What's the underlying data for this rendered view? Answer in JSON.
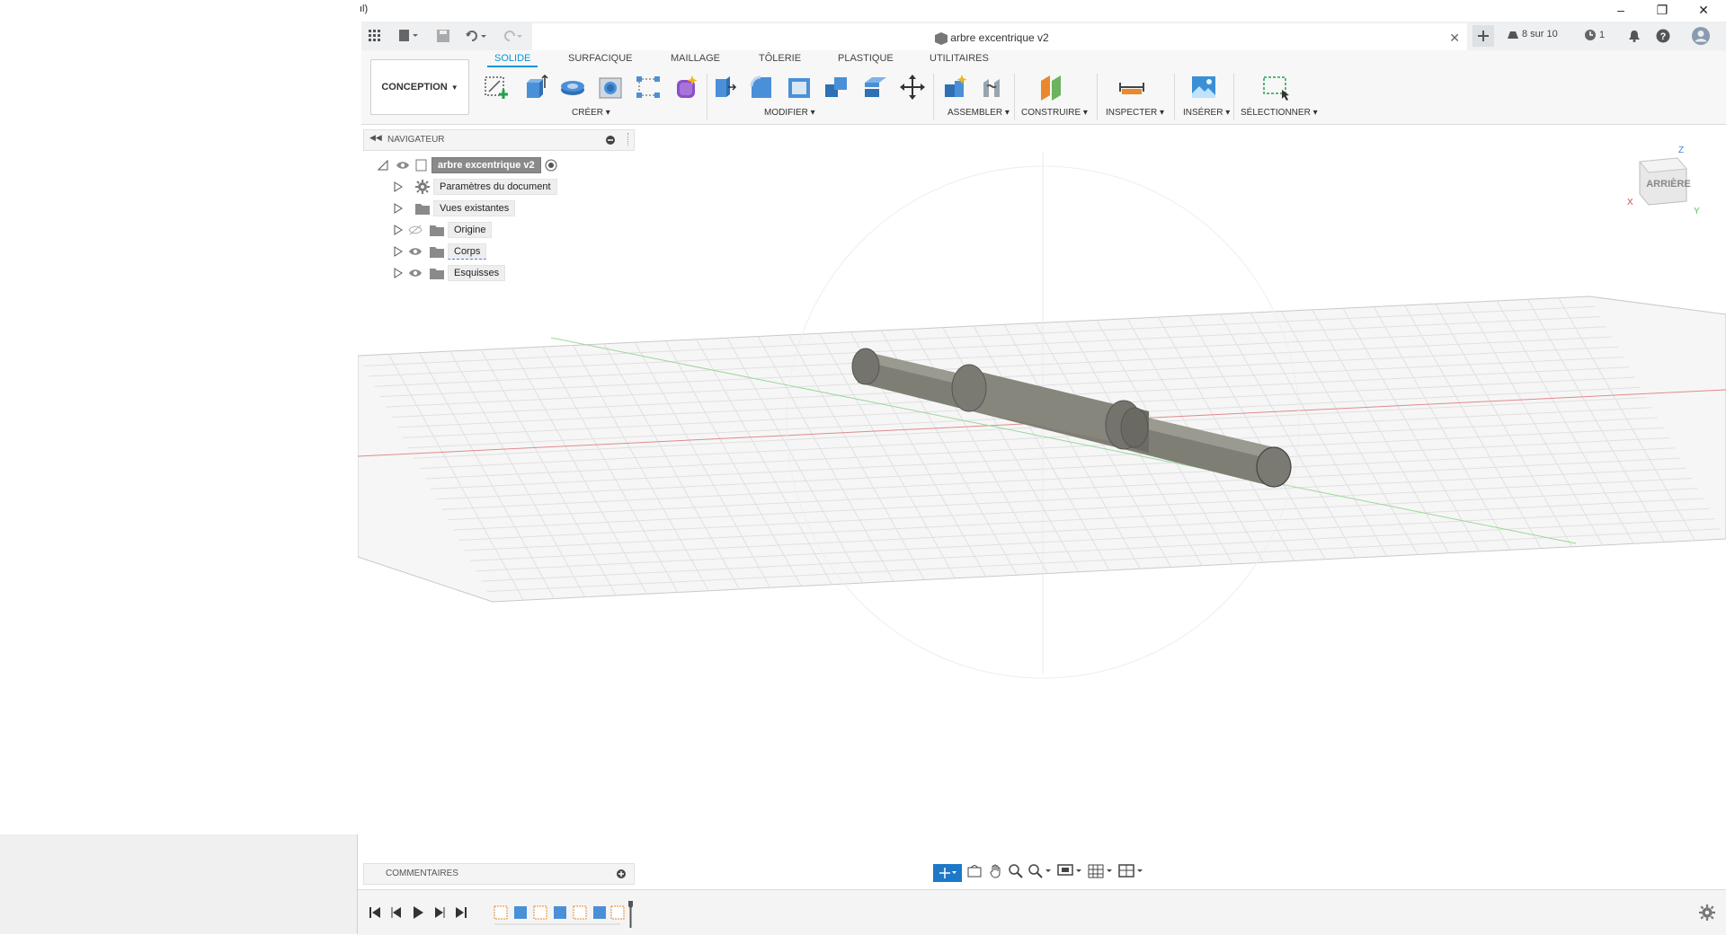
{
  "system": {
    "indicator": "ıl)"
  },
  "window": {
    "minimize_icon": "minimize-icon",
    "maximize_icon": "restore-icon",
    "close_icon": "close-icon"
  },
  "appbar": {
    "document_title": "arbre excentrique v2",
    "version_status": "8 sur 10",
    "jobs_count": "1"
  },
  "ribbon": {
    "workspace": "CONCEPTION",
    "tabs": [
      {
        "label": "SOLIDE",
        "active": true
      },
      {
        "label": "SURFACIQUE",
        "active": false
      },
      {
        "label": "MAILLAGE",
        "active": false
      },
      {
        "label": "TÔLERIE",
        "active": false
      },
      {
        "label": "PLASTIQUE",
        "active": false
      },
      {
        "label": "UTILITAIRES",
        "active": false
      }
    ],
    "groups": {
      "create": "CRÉER",
      "modify": "MODIFIER",
      "assemble": "ASSEMBLER",
      "construct": "CONSTRUIRE",
      "inspect": "INSPECTER",
      "insert": "INSÉRER",
      "select": "SÉLECTIONNER"
    }
  },
  "navigator": {
    "title": "NAVIGATEUR",
    "root": "arbre excentrique v2",
    "items": [
      {
        "label": "Paramètres du document"
      },
      {
        "label": "Vues existantes"
      },
      {
        "label": "Origine"
      },
      {
        "label": "Corps"
      },
      {
        "label": "Esquisses"
      }
    ]
  },
  "viewcube": {
    "face": "ARRIÈRE",
    "axis_x": "X",
    "axis_y": "Y",
    "axis_z": "Z"
  },
  "comments": {
    "title": "COMMENTAIRES"
  },
  "colors": {
    "accent": "#0696d7",
    "x_axis": "#e05050",
    "y_axis": "#50c050"
  }
}
